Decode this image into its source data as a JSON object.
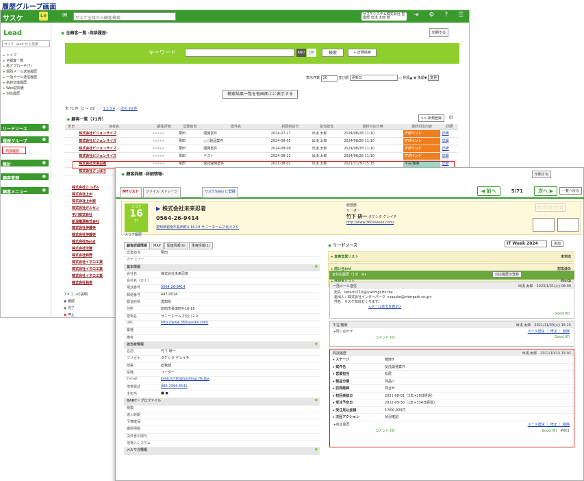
{
  "caption": "履歴グループ画面",
  "topbar": {
    "logo": "サスケ",
    "le": "Le",
    "search_placeholder": "サスケ全体から顧客検索",
    "user": "サスケシステム株式会社 営業部 出浅 太郎 様"
  },
  "lnav": {
    "logo": "Lead",
    "search_placeholder": "サスケ Lead から検索",
    "items": [
      "トップ",
      "全顧客一覧",
      "再アプローチ(7)",
      "個別メール送信履歴",
      "一括メール送信履歴",
      "名刺交換履歴",
      "Web訪問者",
      "対応履歴"
    ],
    "groups": [
      "リードソース",
      "履歴グループ",
      "集計",
      "顧客管理",
      "顧客メニュー"
    ],
    "rireki": "商談履歴",
    "legend_title": "アイコンの説明",
    "legend": [
      "継続",
      "完了",
      "停止"
    ]
  },
  "list": {
    "title": "全顧客一覧 -商談履歴-",
    "print": "印刷する",
    "kw_label": "キーワード",
    "and": "AND",
    "or": "OR",
    "search": "検索",
    "detail_search": "+ 詳細検索",
    "disp_label": "表示件数",
    "disp_num": "20",
    "order_label": "並び順",
    "order_sel": "更新日",
    "asc": "昇順▲",
    "desc": "降順▼",
    "change": "変更",
    "top_disp": "検索結果一覧を他画面上に表示する",
    "pager": "全 71 件［1 ～ 20］ ／",
    "pages": "1 2 3 4",
    "next": "次の 20 件",
    "count": "顧客一覧（71件）",
    "new": ">> 新規登録",
    "headers": [
      "本日",
      "会社名",
      "顧客評価",
      "営業担当",
      "案件名",
      "初回商談日",
      "担当担当",
      "最終対応日時",
      "最終対応内容",
      "詳細"
    ],
    "rows": [
      [
        "株式会社ビジョンサイズ",
        "★★★★★",
        "栗田",
        "開発案件",
        "2024-07-27",
        "出浅 太郎",
        "2024/08/28 11:10",
        "アポイント",
        "詳細"
      ],
      [
        "株式会社ビジョンサイズ",
        "★★★★★",
        "栗田",
        "○○製品案件",
        "2024-08-05",
        "出浅 太郎",
        "2024/08/28 11:10",
        "アポイント",
        "詳細"
      ],
      [
        "株式会社ビジョンサイズ",
        "★★★★★",
        "栗田",
        "開発案件",
        "2024-08-09",
        "出浅 太郎",
        "2024/08/28 11:10",
        "アポイント",
        "詳細"
      ],
      [
        "株式会社ビジョンサイズ",
        "★★★★★",
        "栗田",
        "テスト",
        "2024-08-22",
        "出浅 太郎",
        "2024/08/28 11:10",
        "アポイント",
        "詳細"
      ],
      [
        "株式会社未来忍者",
        "★★★★★",
        "栗田",
        "受託開発案件",
        "2021-08-01",
        "出浅 太郎",
        "2021/11/30 15:15",
        "不在/離席",
        "詳細"
      ],
      [
        "株式会社さっぽろ",
        "★★★★★",
        "栗田",
        "採用パンフレット制作",
        "2024-04-01",
        "出浅 太郎",
        "2019/08/01 13:24",
        "アポイント",
        "詳細"
      ]
    ],
    "more": [
      "株式会社さっぽろ",
      "株式会社上州",
      "株式会社上州屋",
      "株式会社ガルセン",
      "平川株式会社",
      "新潟電源株式会社",
      "株式会社伊藤寺",
      "株式会社伊藤寺",
      "株式会社Band",
      "株式会社法隆",
      "株式会社和野",
      "株式会社イオロエ業",
      "株式会社イオロエ業",
      "株式会社イオロエ業",
      "株式会社和泉"
    ]
  },
  "detail": {
    "title": "顧客詳細 -詳細情報-",
    "print": "印刷する",
    "tabs": [
      "MYリスト",
      "ファイル ストレージ",
      "サスケSales に登録"
    ],
    "prev": "前へ",
    "page": "5/71",
    "next": "次へ",
    "back": "一覧へ戻る",
    "score_label": "スコア",
    "score": "16",
    "score_unit": "pt",
    "score_link": "スコア履歴",
    "company": "株式会社未来忍者",
    "tel": "0564-26-9414",
    "address": "愛知県碧南市長田町4-16-18 サニーホームズ北川２０",
    "dept": "総務部",
    "role": "リーダー",
    "person": "竹下 研一",
    "kana": "タケシタ ケンイチ",
    "url": "http://www.360saaske.com/",
    "rating": "☆☆☆☆☆",
    "ltabs": [
      "顧客詳細情報",
      "MAP",
      "関連情報(0)",
      "重複情報(1)"
    ],
    "info": [
      [
        "営業担当",
        "栗田",
        false
      ],
      [
        "カテゴリー",
        "",
        false
      ]
    ],
    "sec1": "基本情報",
    "basic": [
      [
        "会社名",
        "株式会社未来忍者",
        false
      ],
      [
        "会社名（カナ）",
        "",
        false
      ],
      [
        "電話番号",
        "0564-26-9414",
        true
      ],
      [
        "郵便番号",
        "447-0014",
        false
      ],
      [
        "都道府県",
        "愛知県",
        false
      ],
      [
        "住所",
        "碧南市長田町4-16-18",
        false
      ],
      [
        "建物名",
        "サニーホームズ北川２０",
        false
      ],
      [
        "URL",
        "http://www.360saaske.com/",
        true
      ],
      [
        "業種",
        "",
        false
      ],
      [
        "備考",
        "",
        false
      ]
    ],
    "sec2": "担当者情報",
    "person_rows": [
      [
        "名前",
        "竹下 研一",
        false
      ],
      [
        "フリガナ",
        "タケシタ ケンイチ",
        false
      ],
      [
        "部署",
        "総務部",
        false
      ],
      [
        "役職",
        "リーダー",
        false
      ],
      [
        "E-mail",
        "kenichi710@lyixilmgr.ffs.tba",
        true
      ],
      [
        "携帯電話",
        "080-2394-4541",
        true
      ],
      [
        "主担当",
        "■ ●",
        false
      ]
    ],
    "sec3": "BANT・プロファイル",
    "bant": [
      [
        "規模",
        "",
        false
      ],
      [
        "導入時期",
        "",
        false
      ],
      [
        "予算確保",
        "",
        false
      ],
      [
        "課題把握",
        "",
        false
      ],
      [
        "決済者の関与",
        "",
        false
      ],
      [
        "他導入システム",
        "",
        false
      ]
    ],
    "sec4": "メルマガ情報",
    "lead_title": "リードソース",
    "lead_sel": "IT Week 2024",
    "add": "追加",
    "leads": [
      [
        "倉庫営業リスト",
        "未対応"
      ],
      [
        "問い合わせ",
        "対応済み"
      ],
      [
        "既存客リスト",
        "取引中"
      ]
    ],
    "hist_title": "全対応履歴（13）",
    "hist_btn": "対応履歴の登録",
    "c1": {
      "type": "一括メール送信",
      "user": "出浅 太郎",
      "date": "2023/1/31(火) 06:00",
      "to": "宛先：kenichi710@lyixilmgr.ffs.tba",
      "from": "差出人：株式会社インターパーク <saaske@interpark.co.jp>",
      "subject": "件名：サスケ商料おくります。",
      "show": "<メール本文を表示>",
      "good": "Good (0)"
    },
    "c2": {
      "type": "不在/離席",
      "user": "出浅 太郎",
      "date": "2021/11/30(火) 15:15",
      "sub": "▸問い合わせ",
      "links": "メール送信 ｜ 修正 ｜ 削除",
      "comment": "コメント (0)",
      "good": "Good (0)"
    },
    "c3": {
      "type": "商談履歴",
      "user": "出浅 太郎",
      "date": "2021/10/13 15:02",
      "rows": [
        [
          "ステージ",
          "確度B"
        ],
        [
          "案件名",
          "受託開発案件"
        ],
        [
          "営業担当",
          "松尾"
        ],
        [
          "製品分類",
          "商品D"
        ],
        [
          "訪問経緯",
          "問合せ"
        ],
        [
          "初回商談日",
          "2021-08-01（3年+29日経過）"
        ],
        [
          "受注予定日",
          "2022-09-30（1年+334日経過）"
        ],
        [
          "受注見込金額",
          "1,500,000円"
        ],
        [
          "次回アクション",
          "状況確認"
        ]
      ],
      "sub": "▸商談履歴",
      "links": "メール送信 ｜ 修正 ｜ 削除",
      "comment": "コメント (0)",
      "good": "Good (0)",
      "id": "#661"
    }
  }
}
